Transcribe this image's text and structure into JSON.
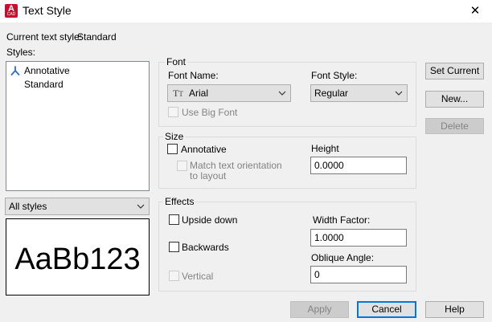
{
  "window": {
    "title": "Text Style",
    "app_icon_letter": "A",
    "app_icon_sub": "CAD",
    "close_symbol": "✕"
  },
  "current_style": {
    "label": "Current text style:",
    "value": "Standard"
  },
  "styles": {
    "label": "Styles:",
    "items": [
      {
        "label": "Annotative",
        "annotative": true
      },
      {
        "label": "Standard",
        "annotative": false
      }
    ],
    "filter": "All styles"
  },
  "preview": {
    "text": "AaBb123"
  },
  "font": {
    "group_label": "Font",
    "name_label": "Font Name:",
    "name_value": "Arial",
    "style_label": "Font Style:",
    "style_value": "Regular",
    "big_font_label": "Use Big Font"
  },
  "size": {
    "group_label": "Size",
    "annotative_label": "Annotative",
    "match_label_line1": "Match text orientation",
    "match_label_line2": "to layout",
    "height_label": "Height",
    "height_value": "0.0000"
  },
  "effects": {
    "group_label": "Effects",
    "upside_down_label": "Upside down",
    "backwards_label": "Backwards",
    "vertical_label": "Vertical",
    "width_factor_label": "Width Factor:",
    "width_factor_value": "1.0000",
    "oblique_label": "Oblique Angle:",
    "oblique_value": "0"
  },
  "buttons": {
    "set_current": "Set Current",
    "new": "New...",
    "delete": "Delete",
    "apply": "Apply",
    "cancel": "Cancel",
    "help": "Help"
  },
  "colors": {
    "accent": "#0078d7",
    "autocad_red": "#c7102e",
    "annotative_icon": "#2b6cc4"
  }
}
